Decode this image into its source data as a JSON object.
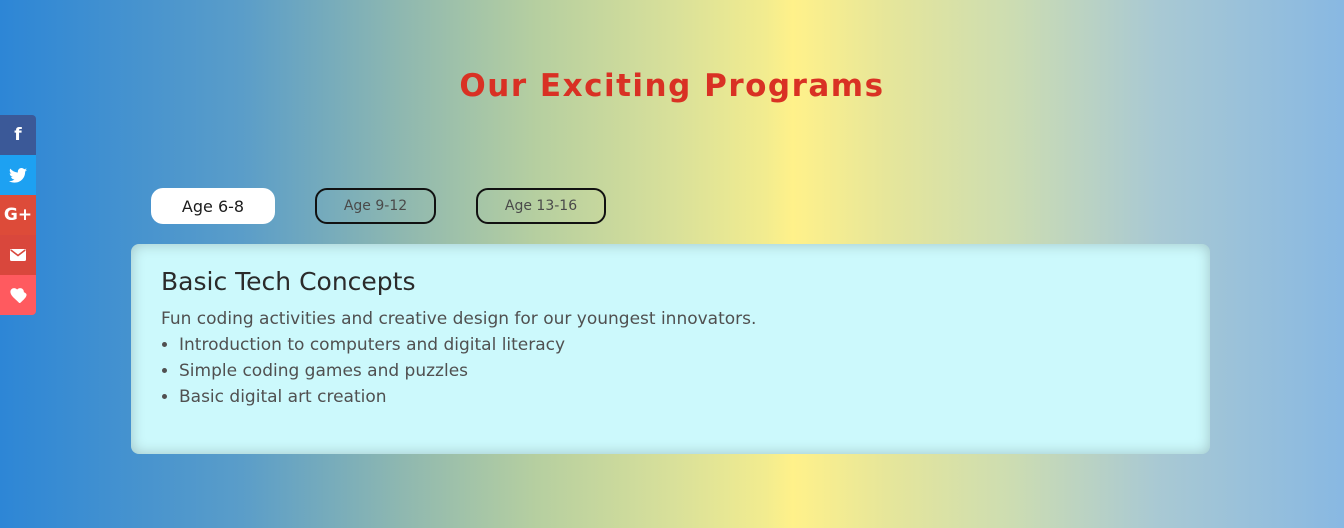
{
  "page": {
    "title": "Our Exciting Programs"
  },
  "social": {
    "items": [
      {
        "icon": "facebook-icon",
        "glyph": "f",
        "color": "#3b5998"
      },
      {
        "icon": "twitter-icon",
        "glyph": "🐦",
        "color": "#1da1f2"
      },
      {
        "icon": "google-plus-icon",
        "glyph": "G+",
        "color": "#dd4b39"
      },
      {
        "icon": "email-icon",
        "glyph": "✉",
        "color": "#d9473c"
      },
      {
        "icon": "heart-icon",
        "glyph": "♥",
        "color": "#ff5a5f"
      }
    ]
  },
  "tabs": [
    {
      "label": "Age 6-8",
      "active": true
    },
    {
      "label": "Age 9-12",
      "active": false
    },
    {
      "label": "Age 13-16",
      "active": false
    }
  ],
  "program": {
    "title": "Basic Tech Concepts",
    "description": "Fun coding activities and creative design for our youngest innovators.",
    "items": [
      "Introduction to computers and digital literacy",
      "Simple coding games and puzzles",
      "Basic digital art creation"
    ]
  },
  "colors": {
    "title": "#d93124",
    "card_bg": "#ccf9fc",
    "active_tab_bg": "#ffffff"
  }
}
